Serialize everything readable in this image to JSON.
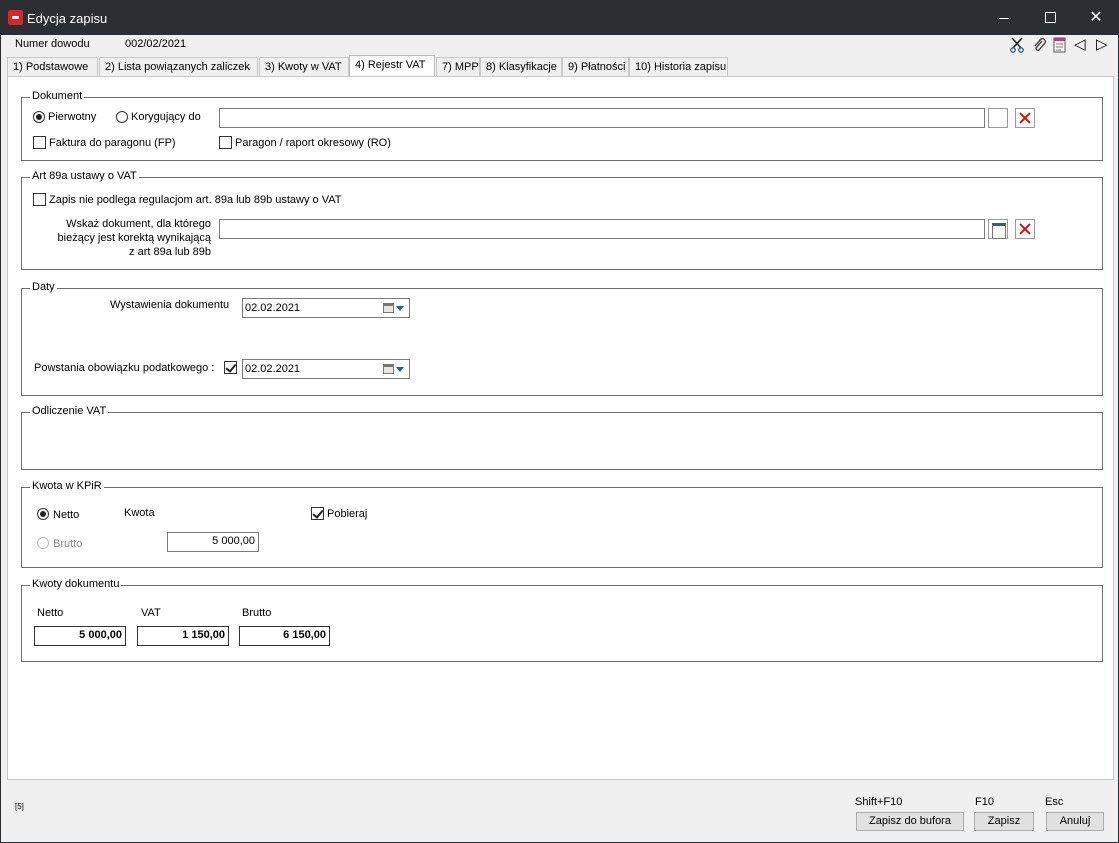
{
  "window": {
    "title": "Edycja zapisu",
    "close_glyph": "✕"
  },
  "header": {
    "doc_number_label": "Numer dowodu",
    "doc_number_value": "002/02/2021"
  },
  "toolbar": {
    "icons": [
      "scissors-icon",
      "paperclip-icon",
      "document-icon",
      "previous-icon",
      "next-icon"
    ],
    "prev_glyph": "◁",
    "next_glyph": "▷"
  },
  "tabs": [
    {
      "label": "1) Podstawowe"
    },
    {
      "label": "2) Lista powiązanych zaliczek"
    },
    {
      "label": "3) Kwoty w VAT"
    },
    {
      "label": "4) Rejestr VAT",
      "active": true
    },
    {
      "label": "7) MPP"
    },
    {
      "label": "8) Klasyfikacje"
    },
    {
      "label": "9) Płatności"
    },
    {
      "label": "10) Historia zapisu"
    }
  ],
  "dokument": {
    "legend": "Dokument",
    "radio_original": "Pierwotny",
    "radio_correcting": "Korygujący do",
    "selected": "Pierwotny",
    "correcting_value": "",
    "check_fp": "Faktura do paragonu (FP)",
    "check_fp_checked": false,
    "check_ro": "Paragon / raport okresowy (RO)",
    "check_ro_checked": false
  },
  "art89": {
    "legend": "Art 89a ustawy o VAT",
    "check_label": "Zapis nie podlega regulacjom art. 89a lub 89b ustawy o VAT",
    "checked": false,
    "hint_line1": "Wskaż dokument, dla którego",
    "hint_line2": "bieżący jest korektą wynikającą",
    "hint_line3": "z art 89a lub 89b",
    "doc_value": ""
  },
  "daty": {
    "legend": "Daty",
    "issue_label": "Wystawienia dokumentu",
    "issue_value": "02.02.2021",
    "tax_label": "Powstania obowiązku podatkowego  :",
    "tax_checked": true,
    "tax_value": "02.02.2021"
  },
  "odliczenie": {
    "legend": "Odliczenie VAT"
  },
  "kpir": {
    "legend": "Kwota w KPiR",
    "netto_label": "Netto",
    "brutto_label": "Brutto",
    "selected": "Netto",
    "kwota_label": "Kwota",
    "kwota_value": "5 000,00",
    "pobieraj_label": "Pobieraj",
    "pobieraj_checked": true
  },
  "kwoty": {
    "legend": "Kwoty dokumentu",
    "netto_label": "Netto",
    "vat_label": "VAT",
    "brutto_label": "Brutto",
    "netto_value": "5 000,00",
    "vat_value": "1 150,00",
    "brutto_value": "6 150,00"
  },
  "footer": {
    "count_text": "[5]",
    "buffer_shortcut": "Shift+F10",
    "buffer_label": "Zapisz do bufora",
    "save_shortcut": "F10",
    "save_label": "Zapisz",
    "cancel_shortcut": "Esc",
    "cancel_label": "Anuluj"
  }
}
